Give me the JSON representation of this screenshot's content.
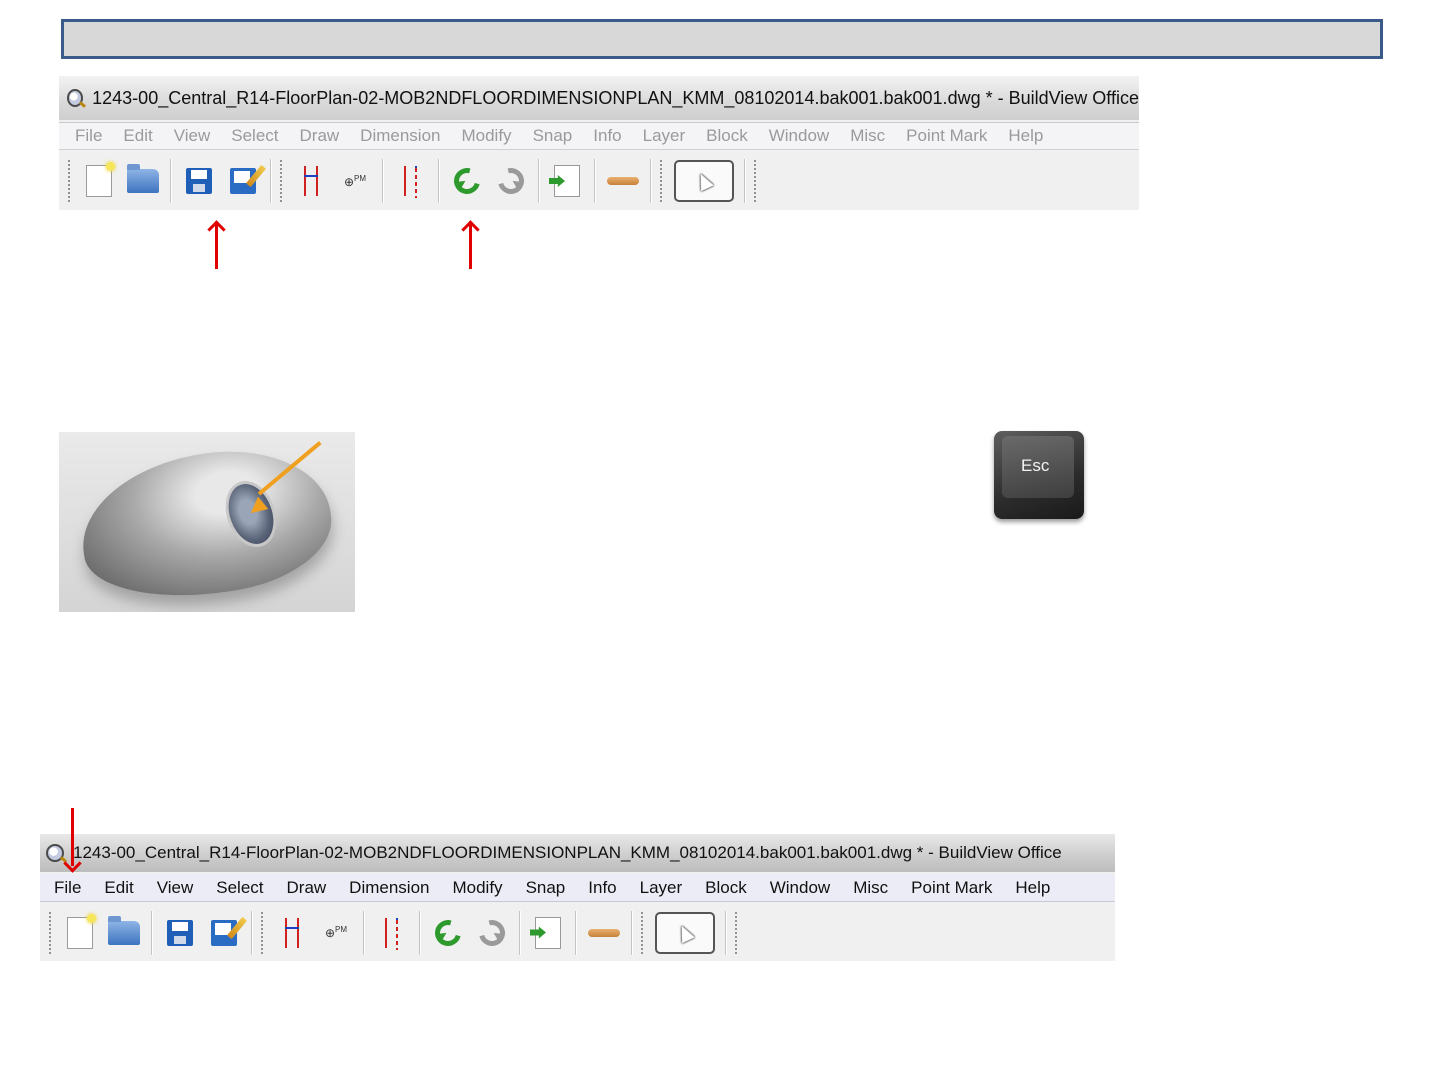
{
  "window_title": "1243-00_Central_R14-FloorPlan-02-MOB2NDFLOORDIMENSIONPLAN_KMM_08102014.bak001.bak001.dwg * - BuildView Office",
  "menu": [
    "File",
    "Edit",
    "View",
    "Select",
    "Draw",
    "Dimension",
    "Modify",
    "Snap",
    "Info",
    "Layer",
    "Block",
    "Window",
    "Misc",
    "Point Mark",
    "Help"
  ],
  "toolbar_icons": [
    "new-file-icon",
    "open-folder-icon",
    "save-icon",
    "save-as-icon",
    "dimension-icon",
    "point-mark-icon",
    "dimension-dashed-icon",
    "undo-icon",
    "redo-icon",
    "import-icon",
    "line-icon",
    "select-cursor-icon"
  ],
  "point_mark_label": "⊕",
  "point_mark_sup": "PM",
  "top_screenshot_menu_state": "disabled",
  "bottom_screenshot_menu_state": "enabled",
  "esc_key_label": "Esc",
  "colors": {
    "header_border": "#3a5a8a",
    "header_fill": "#d8d8d8",
    "callout_arrow": "#e00000",
    "mouse_arrow": "#f0a020"
  }
}
